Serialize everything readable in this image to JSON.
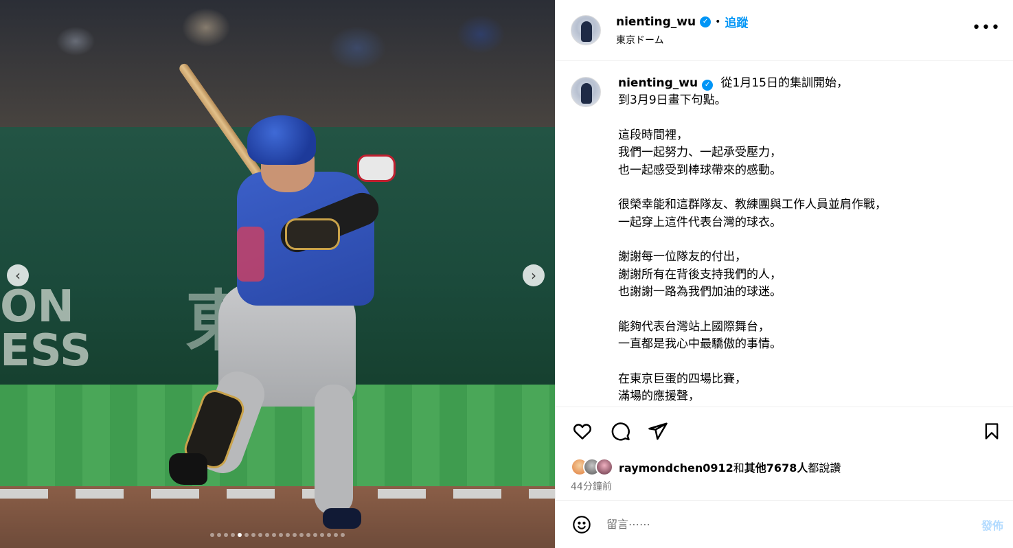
{
  "header": {
    "username": "nienting_wu",
    "separator": "•",
    "follow_label": "追蹤",
    "location": "東京ドーム",
    "more_label": "•••"
  },
  "media": {
    "prev_label": "‹",
    "next_label": "›",
    "slide_count": 20,
    "active_slide": 4,
    "wall_text": "ON\nESS",
    "wall_kanji": "東"
  },
  "caption": {
    "username": "nienting_wu",
    "lines": [
      "從1月15日的集訓開始，",
      "到3月9日畫下句點。",
      "",
      "這段時間裡，",
      "我們一起努力、一起承受壓力，",
      "也一起感受到棒球帶來的感動。",
      "",
      "很榮幸能和這群隊友、教練團與工作人員並肩作戰，",
      "一起穿上這件代表台灣的球衣。",
      "",
      "謝謝每一位隊友的付出，",
      "謝謝所有在背後支持我們的人，",
      "也謝謝一路為我們加油的球迷。",
      "",
      "能夠代表台灣站上國際舞台，",
      "一直都是我心中最驕傲的事情。",
      "",
      "在東京巨蛋的四場比賽，",
      "滿場的應援聲，"
    ]
  },
  "likes": {
    "liker": "raymondchen0912",
    "conjunction": "和",
    "others": "其他7678人",
    "suffix": "都說讚"
  },
  "timestamp": "44分鐘前",
  "comment": {
    "placeholder": "留言⋯⋯",
    "post_label": "發佈"
  },
  "colors": {
    "accent": "#0095f6",
    "post_disabled": "#b3dbff",
    "muted": "#737373"
  },
  "icons": {
    "like": "heart-icon",
    "comment": "comment-icon",
    "share": "share-icon",
    "save": "bookmark-icon",
    "emoji": "emoji-icon",
    "verified": "verified-badge-icon"
  }
}
